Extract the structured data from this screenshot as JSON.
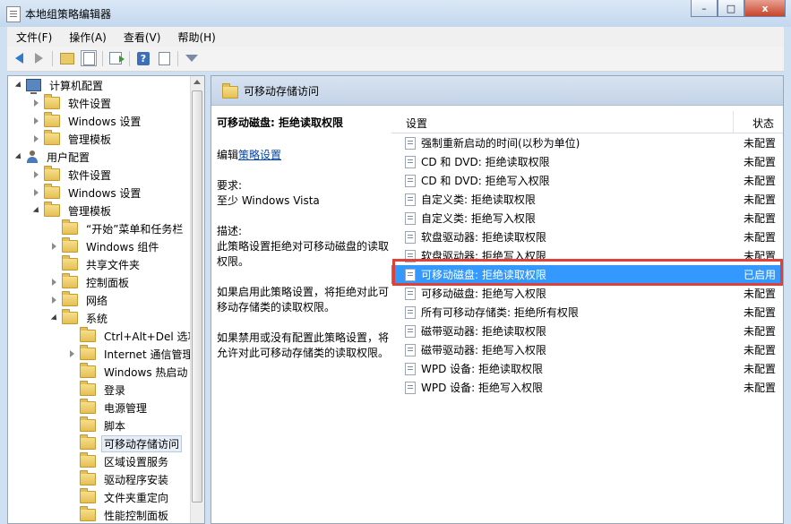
{
  "window": {
    "title": "本地组策略编辑器",
    "minimize": "–",
    "restore": "□",
    "close": "x"
  },
  "menu": [
    {
      "label": "文件(F)"
    },
    {
      "label": "操作(A)"
    },
    {
      "label": "查看(V)"
    },
    {
      "label": "帮助(H)"
    }
  ],
  "toolbar": {
    "help": "?"
  },
  "tree": [
    {
      "label": "计算机配置",
      "level": 0,
      "expander": "down",
      "icon": "computer-icon"
    },
    {
      "label": "软件设置",
      "level": 1,
      "expander": "right",
      "icon": "folder-icon"
    },
    {
      "label": "Windows 设置",
      "level": 1,
      "expander": "right",
      "icon": "folder-icon"
    },
    {
      "label": "管理模板",
      "level": 1,
      "expander": "right",
      "icon": "folder-icon"
    },
    {
      "label": "用户配置",
      "level": 0,
      "expander": "down",
      "icon": "user-icon"
    },
    {
      "label": "软件设置",
      "level": 1,
      "expander": "right",
      "icon": "folder-icon"
    },
    {
      "label": "Windows 设置",
      "level": 1,
      "expander": "right",
      "icon": "folder-icon"
    },
    {
      "label": "管理模板",
      "level": 1,
      "expander": "down",
      "icon": "folder-icon"
    },
    {
      "label": "“开始”菜单和任务栏",
      "level": 2,
      "expander": "none",
      "icon": "folder-icon"
    },
    {
      "label": "Windows 组件",
      "level": 2,
      "expander": "right",
      "icon": "folder-icon"
    },
    {
      "label": "共享文件夹",
      "level": 2,
      "expander": "none",
      "icon": "folder-icon"
    },
    {
      "label": "控制面板",
      "level": 2,
      "expander": "right",
      "icon": "folder-icon"
    },
    {
      "label": "网络",
      "level": 2,
      "expander": "right",
      "icon": "folder-icon"
    },
    {
      "label": "系统",
      "level": 2,
      "expander": "down",
      "icon": "folder-icon"
    },
    {
      "label": "Ctrl+Alt+Del 选项",
      "level": 3,
      "expander": "none",
      "icon": "folder-icon"
    },
    {
      "label": "Internet 通信管理",
      "level": 3,
      "expander": "right",
      "icon": "folder-icon"
    },
    {
      "label": "Windows 热启动",
      "level": 3,
      "expander": "none",
      "icon": "folder-icon"
    },
    {
      "label": "登录",
      "level": 3,
      "expander": "none",
      "icon": "folder-icon"
    },
    {
      "label": "电源管理",
      "level": 3,
      "expander": "none",
      "icon": "folder-icon"
    },
    {
      "label": "脚本",
      "level": 3,
      "expander": "none",
      "icon": "folder-icon"
    },
    {
      "label": "可移动存储访问",
      "level": 3,
      "expander": "none",
      "icon": "folder-icon",
      "selected": true
    },
    {
      "label": "区域设置服务",
      "level": 3,
      "expander": "none",
      "icon": "folder-icon"
    },
    {
      "label": "驱动程序安装",
      "level": 3,
      "expander": "none",
      "icon": "folder-icon"
    },
    {
      "label": "文件夹重定向",
      "level": 3,
      "expander": "none",
      "icon": "folder-icon"
    },
    {
      "label": "性能控制面板",
      "level": 3,
      "expander": "none",
      "icon": "folder-icon"
    }
  ],
  "panel": {
    "title": "可移动存储访问",
    "description": {
      "policy_title": "可移动磁盘: 拒绝读取权限",
      "edit_prefix": "编辑",
      "edit_link": "策略设置",
      "req_label": "要求:",
      "req_value": "至少 Windows Vista",
      "desc_label": "描述:",
      "desc_text": "此策略设置拒绝对可移动磁盘的读取权限。",
      "enabled_text": "如果启用此策略设置，将拒绝对此可移动存储类的读取权限。",
      "disabled_text": "如果禁用或没有配置此策略设置，将允许对此可移动存储类的读取权限。"
    },
    "columns": {
      "setting": "设置",
      "state": "状态"
    },
    "rows": [
      {
        "name": "强制重新启动的时间(以秒为单位)",
        "state": "未配置"
      },
      {
        "name": "CD 和 DVD: 拒绝读取权限",
        "state": "未配置"
      },
      {
        "name": "CD 和 DVD: 拒绝写入权限",
        "state": "未配置"
      },
      {
        "name": "自定义类: 拒绝读取权限",
        "state": "未配置"
      },
      {
        "name": "自定义类: 拒绝写入权限",
        "state": "未配置"
      },
      {
        "name": "软盘驱动器: 拒绝读取权限",
        "state": "未配置"
      },
      {
        "name": "软盘驱动器: 拒绝写入权限",
        "state": "未配置"
      },
      {
        "name": "可移动磁盘: 拒绝读取权限",
        "state": "已启用",
        "selected": true
      },
      {
        "name": "可移动磁盘: 拒绝写入权限",
        "state": "未配置"
      },
      {
        "name": "所有可移动存储类: 拒绝所有权限",
        "state": "未配置"
      },
      {
        "name": "磁带驱动器: 拒绝读取权限",
        "state": "未配置"
      },
      {
        "name": "磁带驱动器: 拒绝写入权限",
        "state": "未配置"
      },
      {
        "name": "WPD 设备: 拒绝读取权限",
        "state": "未配置"
      },
      {
        "name": "WPD 设备: 拒绝写入权限",
        "state": "未配置"
      }
    ]
  }
}
